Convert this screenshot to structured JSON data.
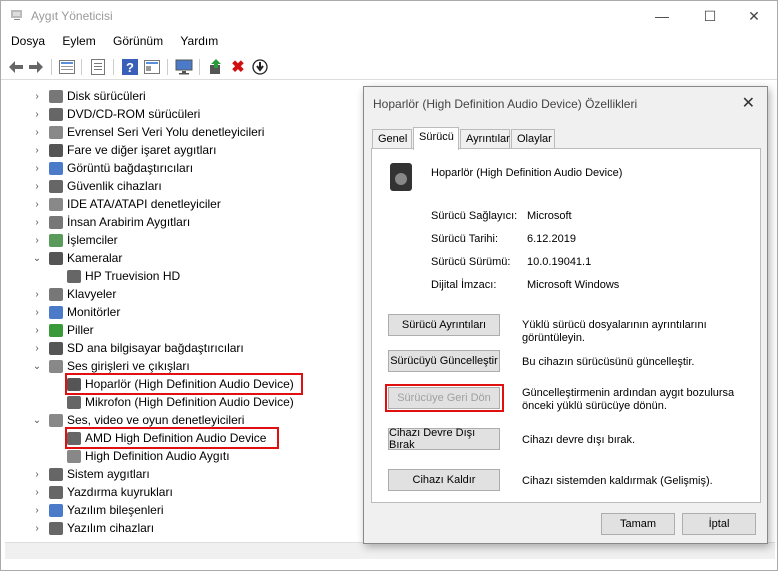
{
  "window": {
    "title": "Aygıt Yöneticisi",
    "minimize_glyph": "—",
    "maximize_glyph": "☐",
    "close_glyph": "✕"
  },
  "menu": [
    "Dosya",
    "Eylem",
    "Görünüm",
    "Yardım"
  ],
  "toolbar": {
    "icons": [
      "back-icon",
      "forward-icon",
      "properties-view-icon",
      "list-icon",
      "help-icon",
      "update-icon",
      "monitor-icon",
      "enable-driver-icon",
      "uninstall-icon",
      "download-icon"
    ]
  },
  "tree": {
    "items": [
      {
        "label": "Disk sürücüleri",
        "expander": "›",
        "icon": "disk-drive-icon"
      },
      {
        "label": "DVD/CD-ROM sürücüleri",
        "expander": "›",
        "icon": "dvd-drive-icon"
      },
      {
        "label": "Evrensel Seri Veri Yolu denetleyicileri",
        "expander": "›",
        "icon": "usb-controller-icon"
      },
      {
        "label": "Fare ve diğer işaret aygıtları",
        "expander": "›",
        "icon": "mouse-icon"
      },
      {
        "label": "Görüntü bağdaştırıcıları",
        "expander": "›",
        "icon": "display-adapter-icon"
      },
      {
        "label": "Güvenlik cihazları",
        "expander": "›",
        "icon": "security-device-icon"
      },
      {
        "label": "IDE ATA/ATAPI denetleyiciler",
        "expander": "›",
        "icon": "ide-controller-icon"
      },
      {
        "label": "İnsan Arabirim Aygıtları",
        "expander": "›",
        "icon": "hid-icon"
      },
      {
        "label": "İşlemciler",
        "expander": "›",
        "icon": "processor-icon"
      },
      {
        "label": "Kameralar",
        "expander": "⌄",
        "icon": "camera-icon"
      },
      {
        "label": "HP Truevision HD",
        "expander": "",
        "icon": "webcam-icon",
        "child": true
      },
      {
        "label": "Klavyeler",
        "expander": "›",
        "icon": "keyboard-icon"
      },
      {
        "label": "Monitörler",
        "expander": "›",
        "icon": "monitor-icon"
      },
      {
        "label": "Piller",
        "expander": "›",
        "icon": "battery-icon"
      },
      {
        "label": "SD ana bilgisayar bağdaştırıcıları",
        "expander": "›",
        "icon": "sd-host-icon"
      },
      {
        "label": "Ses girişleri ve çıkışları",
        "expander": "⌄",
        "icon": "audio-io-icon"
      },
      {
        "label": "Hoparlör (High Definition Audio Device)",
        "expander": "",
        "icon": "speaker-icon",
        "child": true,
        "highlighted": true
      },
      {
        "label": "Mikrofon (High Definition Audio Device)",
        "expander": "",
        "icon": "microphone-icon",
        "child": true
      },
      {
        "label": "Ses, video ve oyun denetleyicileri",
        "expander": "⌄",
        "icon": "sound-controller-icon"
      },
      {
        "label": "AMD High Definition Audio Device",
        "expander": "",
        "icon": "audio-device-icon",
        "child": true,
        "highlighted": true
      },
      {
        "label": "High Definition Audio Aygıtı",
        "expander": "",
        "icon": "audio-device-icon",
        "child": true
      },
      {
        "label": "Sistem aygıtları",
        "expander": "›",
        "icon": "system-device-icon"
      },
      {
        "label": "Yazdırma kuyrukları",
        "expander": "›",
        "icon": "print-queue-icon"
      },
      {
        "label": "Yazılım bileşenleri",
        "expander": "›",
        "icon": "software-component-icon"
      },
      {
        "label": "Yazılım cihazları",
        "expander": "›",
        "icon": "software-device-icon"
      }
    ]
  },
  "dialog": {
    "title": "Hoparlör (High Definition Audio Device) Özellikleri",
    "close_glyph": "✕",
    "tabs": [
      "Genel",
      "Sürücü",
      "Ayrıntılar",
      "Olaylar"
    ],
    "active_tab": "Sürücü",
    "device_name": "Hoparlör (High Definition Audio Device)",
    "fields": [
      {
        "label": "Sürücü Sağlayıcı:",
        "value": "Microsoft"
      },
      {
        "label": "Sürücü Tarihi:",
        "value": "6.12.2019"
      },
      {
        "label": "Sürücü Sürümü:",
        "value": "10.0.19041.1"
      },
      {
        "label": "Dijital İmzacı:",
        "value": "Microsoft Windows"
      }
    ],
    "actions": [
      {
        "button": "Sürücü Ayrıntıları",
        "desc": "Yüklü sürücü dosyalarının ayrıntılarını görüntüleyin.",
        "disabled": false
      },
      {
        "button": "Sürücüyü Güncelleştir",
        "desc": "Bu cihazın sürücüsünü güncelleştir.",
        "disabled": false
      },
      {
        "button": "Sürücüye Geri Dön",
        "desc": "Güncelleştirmenin ardından aygıt bozulursa önceki yüklü sürücüye dönün.",
        "disabled": true,
        "highlighted": true
      },
      {
        "button": "Cihazı Devre Dışı Bırak",
        "desc": "Cihazı devre dışı bırak.",
        "disabled": false
      },
      {
        "button": "Cihazı Kaldır",
        "desc": "Cihazı sistemden kaldırmak (Gelişmiş).",
        "disabled": false
      }
    ],
    "ok_label": "Tamam",
    "cancel_label": "İptal"
  },
  "colors": {
    "highlight_border": "#e01010",
    "dialog_bg": "#f0f0f0"
  }
}
